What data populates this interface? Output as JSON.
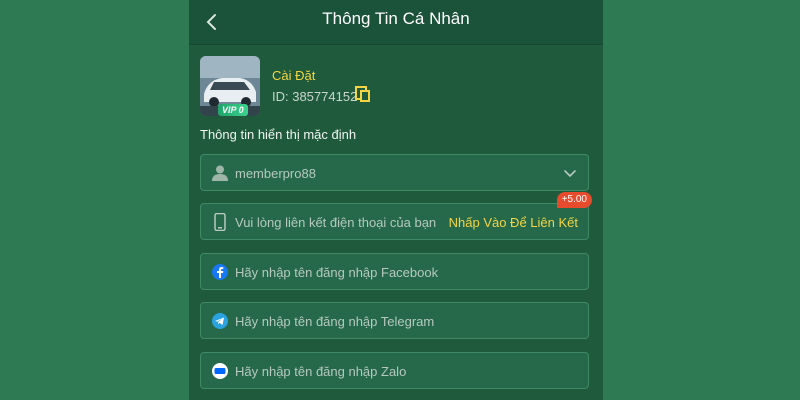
{
  "header": {
    "title": "Thông Tin Cá Nhân"
  },
  "profile": {
    "name": "Cài Đặt",
    "id_text": "ID: 385774152",
    "vip": "VIP 0"
  },
  "section_label": "Thông tin hiển thị mặc định",
  "fields": {
    "username": {
      "value": "memberpro88"
    },
    "phone": {
      "placeholder": "Vui lòng liên kết điện thoại của bạn",
      "action": "Nhấp Vào Để Liên Kết",
      "bonus": "+5.00"
    },
    "facebook": {
      "placeholder": "Hãy nhập tên đăng nhập Facebook"
    },
    "telegram": {
      "placeholder": "Hãy nhập tên đăng nhập Telegram"
    },
    "zalo": {
      "placeholder": "Hãy nhập tên đăng nhập Zalo"
    }
  },
  "colors": {
    "page_bg": "#2e7a52",
    "panel_bg": "#1f5a3c",
    "accent_yellow": "#f3d442",
    "badge_red": "#e64b2e"
  },
  "icons": [
    "back-arrow-icon",
    "copy-icon",
    "user-icon",
    "chevron-down-icon",
    "phone-icon",
    "facebook-icon",
    "telegram-icon",
    "zalo-icon"
  ]
}
